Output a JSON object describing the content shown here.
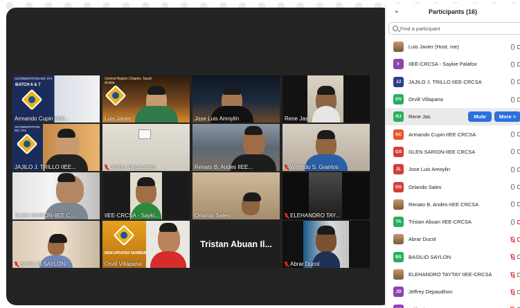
{
  "panel": {
    "title": "Participants (16)",
    "search_placeholder": "Find a participant",
    "mute_label": "Mute",
    "more_label": "More >",
    "participants": [
      {
        "name": "Luis Javier (Host, me)",
        "initials": "",
        "color": "#c9a227",
        "mic": "on",
        "cam": "on"
      },
      {
        "name": "IIEE-CRCSA  -  Saykie Palafox",
        "initials": "I-",
        "color": "#8e44ad",
        "mic": "on",
        "cam": "on"
      },
      {
        "name": "JAJILO J. TRILLO IIEE-CRCSA",
        "initials": "JJ",
        "color": "#2c3e8f",
        "mic": "on",
        "cam": "on"
      },
      {
        "name": "Orvill Villapana",
        "initials": "OV",
        "color": "#27ae60",
        "mic": "on",
        "cam": "on"
      },
      {
        "name": "Rene Jas",
        "initials": "RJ",
        "color": "#27ae60",
        "mic": "on",
        "cam": "on"
      },
      {
        "name": "Armando Cupin-IIEE CRCSA",
        "initials": "AC",
        "color": "#e8542a",
        "mic": "on",
        "cam": "on"
      },
      {
        "name": "GLEN SARION-IIEE CRCSA",
        "initials": "GS",
        "color": "#d63b3b",
        "mic": "on",
        "cam": "on"
      },
      {
        "name": "Jose Luis Amoylin",
        "initials": "JL",
        "color": "#d63b3b",
        "mic": "on",
        "cam": "on"
      },
      {
        "name": "Orlando Sales",
        "initials": "OS",
        "color": "#d63b3b",
        "mic": "on",
        "cam": "on"
      },
      {
        "name": "Renato B. Andes-IIEE CRCSA",
        "initials": "",
        "color": "#b07a50",
        "mic": "on",
        "cam": "on"
      },
      {
        "name": "Tristan Abuan IIEE-CRCSA",
        "initials": "TA",
        "color": "#27ae60",
        "mic": "on",
        "cam": "off"
      },
      {
        "name": "Abrar Ducol",
        "initials": "",
        "color": "#4b6a9b",
        "mic": "off",
        "cam": "off"
      },
      {
        "name": "BASILIO SAYLON",
        "initials": "BS",
        "color": "#27ae60",
        "mic": "off",
        "cam": "on"
      },
      {
        "name": "ELEHANDRO TAYTAY IIEE-CRCSA",
        "initials": "",
        "color": "#3b3b3b",
        "mic": "off",
        "cam": "on"
      },
      {
        "name": "Jeffrey Depaudhon",
        "initials": "JD",
        "color": "#8e44ad",
        "mic": "off",
        "cam": "on"
      },
      {
        "name": "Wilfredo S. Grantos",
        "initials": "WS",
        "color": "#8e44ad",
        "mic": "off",
        "cam": "on"
      }
    ]
  },
  "tiles": {
    "t1": {
      "name": "Armando Cupin  IIEE...",
      "top_text": "ACCREDITATION NO. 074",
      "badge": "BATCH 6 & 7"
    },
    "t2": {
      "name": "Luis Javier",
      "top_text": "Central Region Chapter, Saudi Arabia"
    },
    "t3": {
      "name": "Jose Luis Amoylin"
    },
    "t4": {
      "name": "Rene Jas"
    },
    "t5": {
      "name": "JAJILO J. TRILLO IIEE...",
      "top_text": "ACCREDITATION NO. 074"
    },
    "t6": {
      "name": "Jeffrey Depaudhon"
    },
    "t7": {
      "name": "Renato B. Andes IIEE..."
    },
    "t8": {
      "name": "Wilfredo S. Grantos"
    },
    "t9": {
      "name": "GLEN SARION-IIEE C..."
    },
    "t10": {
      "name": "IIEE-CRCSA  -  Sayki..."
    },
    "t11": {
      "name": "Orlando Sales"
    },
    "t12": {
      "name": "ELEHANDRO TAY..."
    },
    "t13": {
      "name": "BASILIO SAYLON"
    },
    "t14": {
      "name": "Orvill Villapana",
      "banner": "NEW UPDATED NUMBER"
    },
    "t15": {
      "big_text": "Tristan Abuan Il..."
    },
    "t16": {
      "name": "Abrar Ducol"
    }
  },
  "colors": {
    "active_speaker": "#e8cf2e",
    "button": "#2d6fdf",
    "muted": "#e02828"
  }
}
